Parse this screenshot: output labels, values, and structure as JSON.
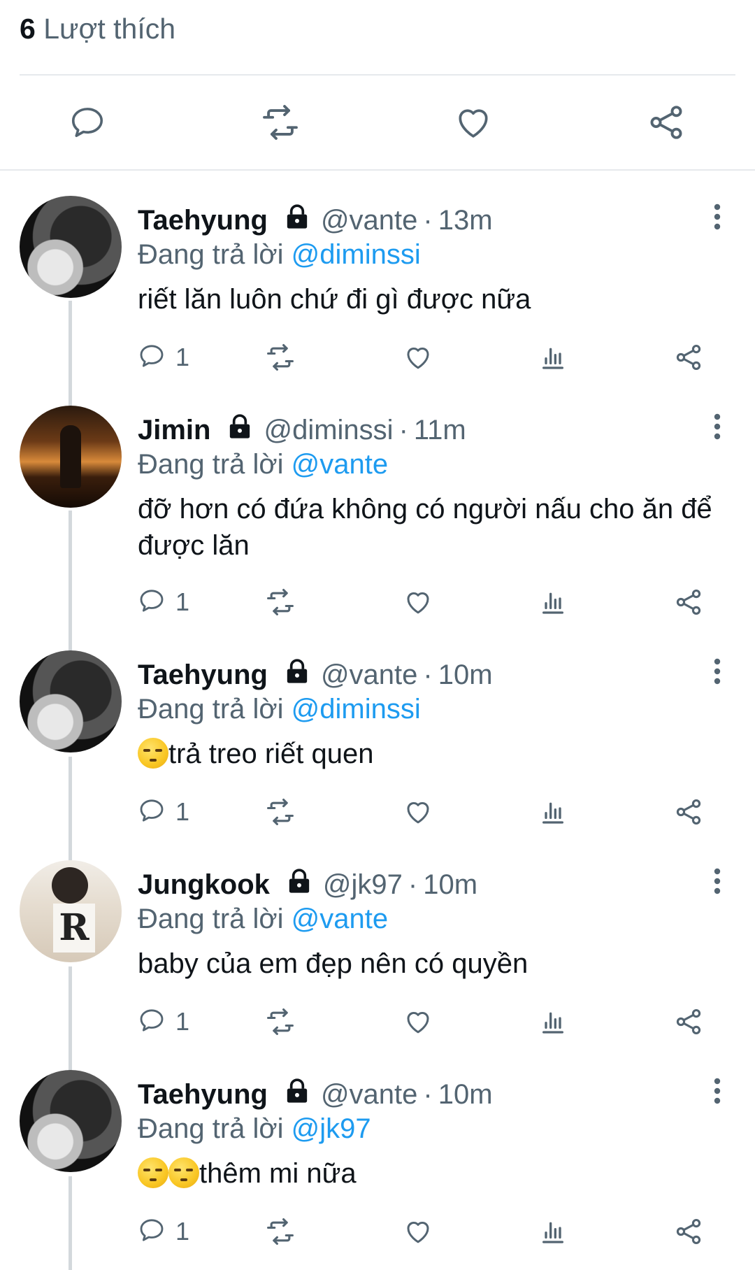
{
  "header": {
    "likes_count": "6",
    "likes_label": "Lượt thích"
  },
  "main_actions": [
    "comment-icon",
    "retweet-icon",
    "heart-icon",
    "share-icon"
  ],
  "replies": [
    {
      "name": "Taehyung",
      "handle": "@vante",
      "time": "13m",
      "replying_prefix": "Đang trả lời",
      "replying_to": "@diminssi",
      "text": "riết lăn luôn chứ đi gì được nữa",
      "emoji_count": 0,
      "reply_count": "1",
      "avatar": "bw"
    },
    {
      "name": "Jimin",
      "handle": "@diminssi",
      "time": "11m",
      "replying_prefix": "Đang trả lời",
      "replying_to": "@vante",
      "text": "đỡ hơn có đứa không có người nấu cho ăn để được lăn",
      "emoji_count": 0,
      "reply_count": "1",
      "avatar": "night"
    },
    {
      "name": "Taehyung",
      "handle": "@vante",
      "time": "10m",
      "replying_prefix": "Đang trả lời",
      "replying_to": "@diminssi",
      "text": "trả treo riết quen",
      "emoji_count": 1,
      "reply_count": "1",
      "avatar": "bw"
    },
    {
      "name": "Jungkook",
      "handle": "@jk97",
      "time": "10m",
      "replying_prefix": "Đang trả lời",
      "replying_to": "@vante",
      "text": "baby của em đẹp nên có quyền",
      "emoji_count": 0,
      "reply_count": "1",
      "avatar": "light"
    },
    {
      "name": "Taehyung",
      "handle": "@vante",
      "time": "10m",
      "replying_prefix": "Đang trả lời",
      "replying_to": "@jk97",
      "text": "thêm mi nữa",
      "emoji_count": 2,
      "reply_count": "1",
      "avatar": "bw"
    }
  ],
  "colors": {
    "text": "#0f1419",
    "secondary": "#536471",
    "link": "#1d9bf0",
    "divider": "#e6e9ec"
  }
}
